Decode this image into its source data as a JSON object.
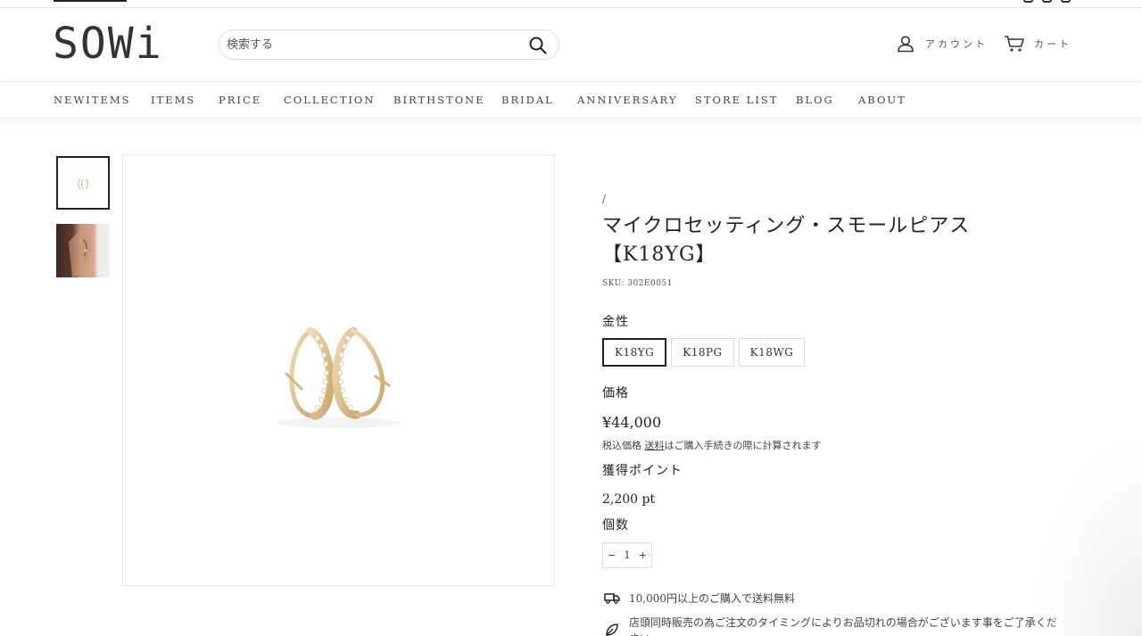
{
  "header": {
    "logo": "SOWi",
    "search_placeholder": "検索する",
    "account_label": "アカウント",
    "cart_label": "カート"
  },
  "nav": {
    "items": [
      "NEWITEMS",
      "ITEMS",
      "PRICE",
      "COLLECTION",
      "BIRTHSTONE",
      "BRIDAL",
      "ANNIVERSARY",
      "STORE LIST",
      "BLOG",
      "ABOUT"
    ]
  },
  "product": {
    "breadcrumb": "/",
    "title_line1": "マイクロセッティング・スモールピアス",
    "title_line2": "【K18YG】",
    "sku": "SKU: 302E0051",
    "metal_label": "金性",
    "variants": [
      "K18YG",
      "K18PG",
      "K18WG"
    ],
    "selected_variant": "K18YG",
    "price_label": "価格",
    "price": "¥44,000",
    "tax_prefix": "税込価格 ",
    "tax_link": "送料",
    "tax_suffix": "はご購入手続きの際に計算されます",
    "points_label": "獲得ポイント",
    "points": "2,200 pt",
    "quantity_label": "個数",
    "quantity_minus": "−",
    "quantity": "1",
    "quantity_plus": "+",
    "shipping_notice": "10,000円以上のご購入で送料無料",
    "stock_notice": "店頭同時販売の為ご注文のタイミングによりお品切れの場合がございます事をご了承ください。"
  },
  "icons": {
    "search": "search-icon",
    "account": "user-icon",
    "cart": "cart-icon",
    "truck": "truck-icon",
    "leaf": "leaf-icon"
  }
}
